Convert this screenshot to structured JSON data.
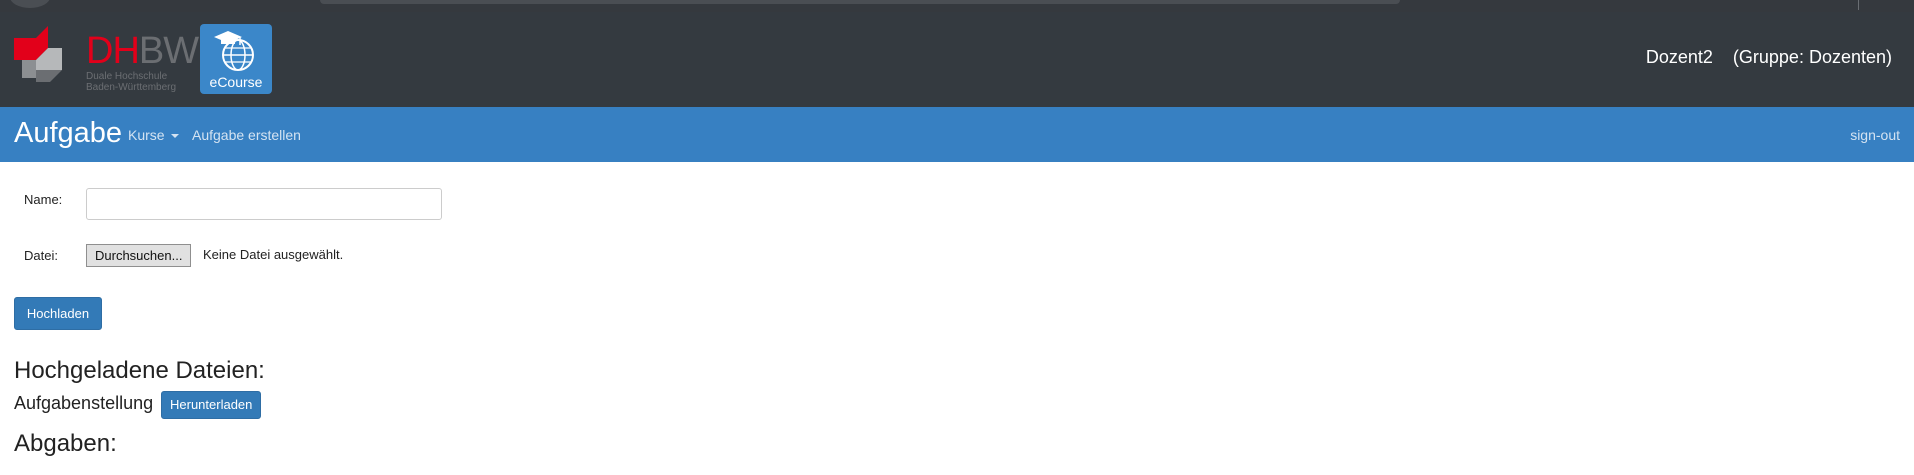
{
  "logo": {
    "dh": "DH",
    "bw": "BW",
    "subtitle_line1": "Duale Hochschule",
    "subtitle_line2": "Baden-Württemberg",
    "app_badge": "eCourse"
  },
  "header": {
    "user": "Dozent2",
    "group": "(Gruppe: Dozenten)"
  },
  "navbar": {
    "title": "Aufgabe",
    "kurse": "Kurse",
    "create_task": "Aufgabe erstellen",
    "sign_out": "sign-out"
  },
  "form": {
    "name_label": "Name:",
    "name_value": "",
    "file_label": "Datei:",
    "browse_button": "Durchsuchen...",
    "file_status": "Keine Datei ausgewählt.",
    "upload_button": "Hochladen"
  },
  "uploaded": {
    "heading": "Hochgeladene Dateien:",
    "item_label": "Aufgabenstellung",
    "download_button": "Herunterladen"
  },
  "submissions": {
    "heading": "Abgaben:"
  },
  "colors": {
    "header_bg": "#343a40",
    "navbar_bg": "#3780c2",
    "primary_button": "#337ab7",
    "brand_red": "#e2001a"
  }
}
